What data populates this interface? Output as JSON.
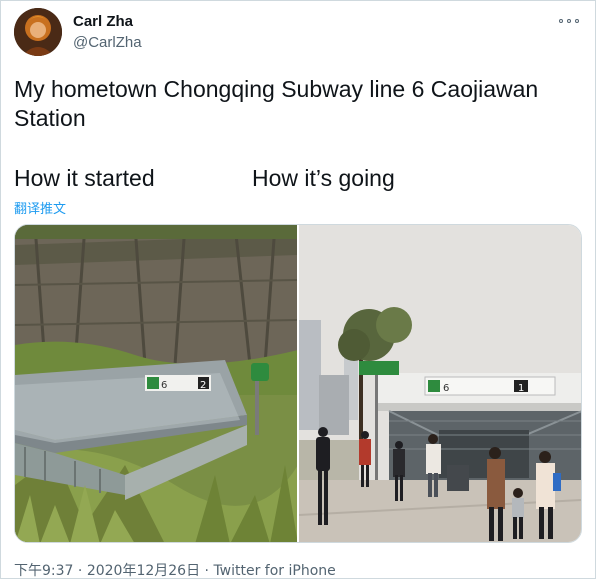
{
  "author": {
    "display_name": "Carl Zha",
    "handle": "@CarlZha",
    "avatar_icon": "avatar-portrait"
  },
  "tweet": {
    "text": "My hometown Chongqing Subway line 6 Caojiawan Station",
    "caption_left": "How it started",
    "caption_right": "How it’s going",
    "translate_label": "翻译推文"
  },
  "media": {
    "photo_left_sign_line": "6",
    "photo_left_sign_exit": "2",
    "photo_right_sign_line": "6",
    "photo_right_sign_exit": "1"
  },
  "footer": {
    "time": "下午9:37",
    "separator": "·",
    "date": "2020年12月26日",
    "source": "Twitter for iPhone"
  },
  "colors": {
    "link": "#1d9bf0",
    "secondary_text": "#536471",
    "border": "#cfd9de",
    "metro_green": "#2e8b3e"
  }
}
